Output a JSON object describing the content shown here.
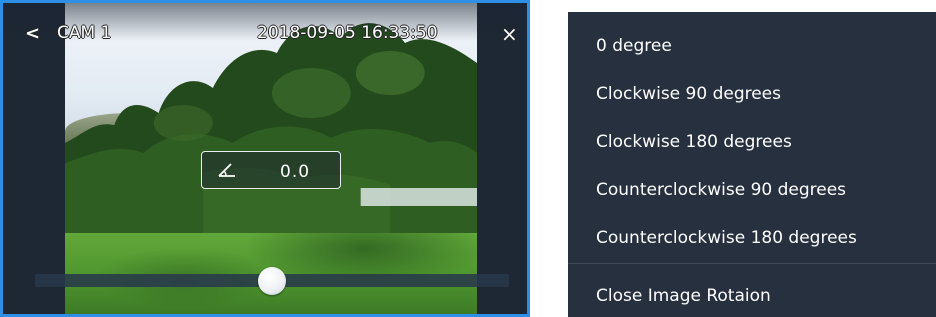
{
  "camera": {
    "name": "CAM 1",
    "timestamp": "2018-09-05 16:33:50",
    "back_icon": "chevron-left-icon",
    "back_glyph": "<",
    "close_icon": "close-icon",
    "close_glyph": "×",
    "rotation_icon": "angle-icon",
    "rotation_value": "0.0",
    "slider_fraction": 0.5,
    "accent_color": "#2f8fe6"
  },
  "menu": {
    "background_color": "#26303f",
    "items": [
      {
        "label": "0 degree"
      },
      {
        "label": "Clockwise 90 degrees"
      },
      {
        "label": "Clockwise 180 degrees"
      },
      {
        "label": "Counterclockwise 90 degrees"
      },
      {
        "label": "Counterclockwise 180 degrees"
      }
    ],
    "close_item": "Close Image Rotaion"
  }
}
